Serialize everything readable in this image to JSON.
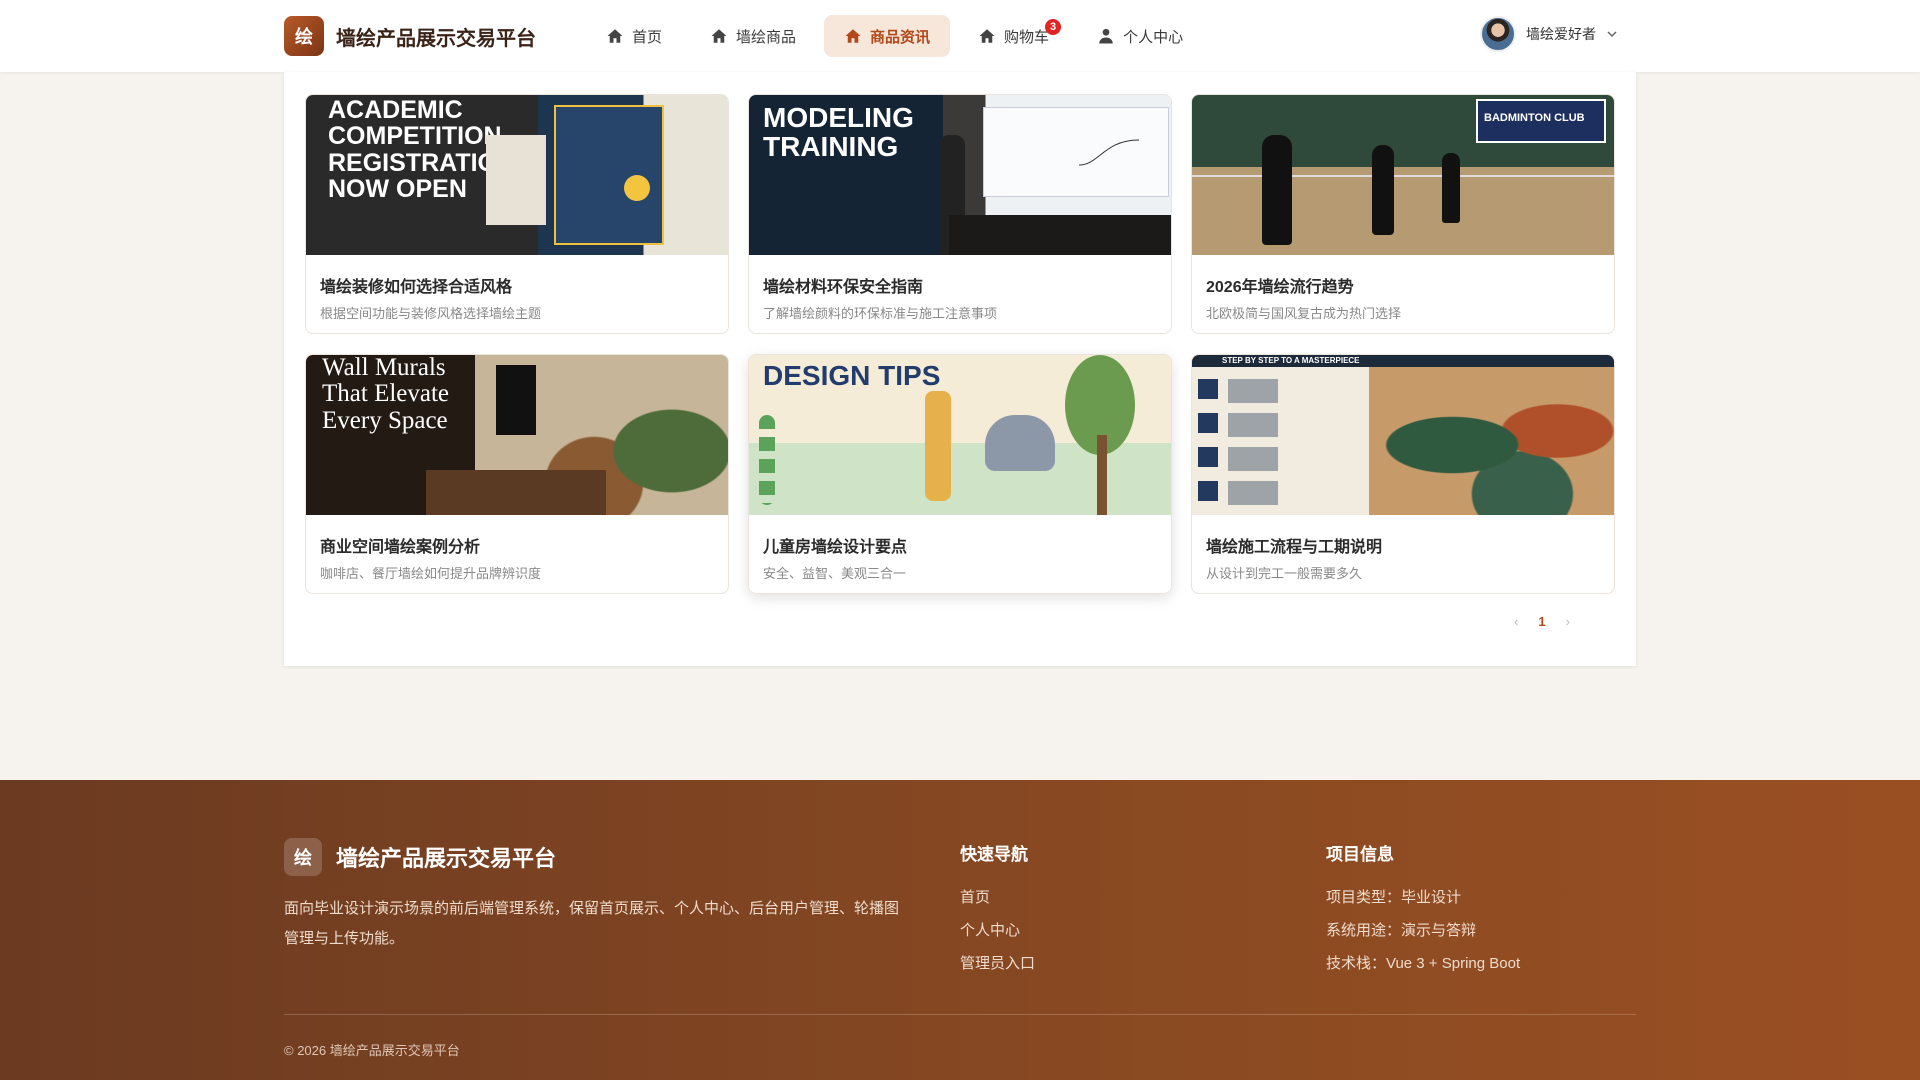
{
  "header": {
    "logo_char": "绘",
    "brand": "墙绘产品展示交易平台",
    "nav": [
      {
        "label": "首页",
        "icon": "home-icon",
        "active": false
      },
      {
        "label": "墙绘商品",
        "icon": "home-icon",
        "active": false
      },
      {
        "label": "商品资讯",
        "icon": "home-icon",
        "active": true
      },
      {
        "label": "购物车",
        "icon": "home-icon",
        "active": false,
        "badge": "3"
      },
      {
        "label": "个人中心",
        "icon": "user-icon",
        "active": false
      }
    ],
    "user_name": "墙绘爱好者"
  },
  "articles": [
    {
      "title": "墙绘装修如何选择合适风格",
      "desc": "根据空间功能与装修风格选择墙绘主题",
      "thumb_text": "ACADEMIC COMPETITION REGISTRATION NOW OPEN"
    },
    {
      "title": "墙绘材料环保安全指南",
      "desc": "了解墙绘颜料的环保标准与施工注意事项",
      "thumb_text": "MODELING TRAINING"
    },
    {
      "title": "2026年墙绘流行趋势",
      "desc": "北欧极简与国风复古成为热门选择",
      "thumb_text": "BADMINTON CLUB"
    },
    {
      "title": "商业空间墙绘案例分析",
      "desc": "咖啡店、餐厅墙绘如何提升品牌辨识度",
      "thumb_text": "Wall Murals That Elevate Every Space"
    },
    {
      "title": "儿童房墙绘设计要点",
      "desc": "安全、益智、美观三合一",
      "thumb_text": "DESIGN TIPS"
    },
    {
      "title": "墙绘施工流程与工期说明",
      "desc": "从设计到完工一般需要多久",
      "thumb_text": "STEP BY STEP TO A MASTERPIECE"
    }
  ],
  "pagination": {
    "prev": "‹",
    "current": "1",
    "next": "›"
  },
  "footer": {
    "logo_char": "绘",
    "brand": "墙绘产品展示交易平台",
    "desc": "面向毕业设计演示场景的前后端管理系统，保留首页展示、个人中心、后台用户管理、轮播图管理与上传功能。",
    "nav_title": "快速导航",
    "nav_links": [
      "首页",
      "个人中心",
      "管理员入口"
    ],
    "info_title": "项目信息",
    "info_items": [
      "项目类型：毕业设计",
      "系统用途：演示与答辩",
      "技术栈：Vue 3 + Spring Boot"
    ],
    "copyright": "© 2026 墙绘产品展示交易平台"
  },
  "colors": {
    "accent": "#b1491b",
    "footer_bg": "#7a4020",
    "badge": "#e02424"
  }
}
